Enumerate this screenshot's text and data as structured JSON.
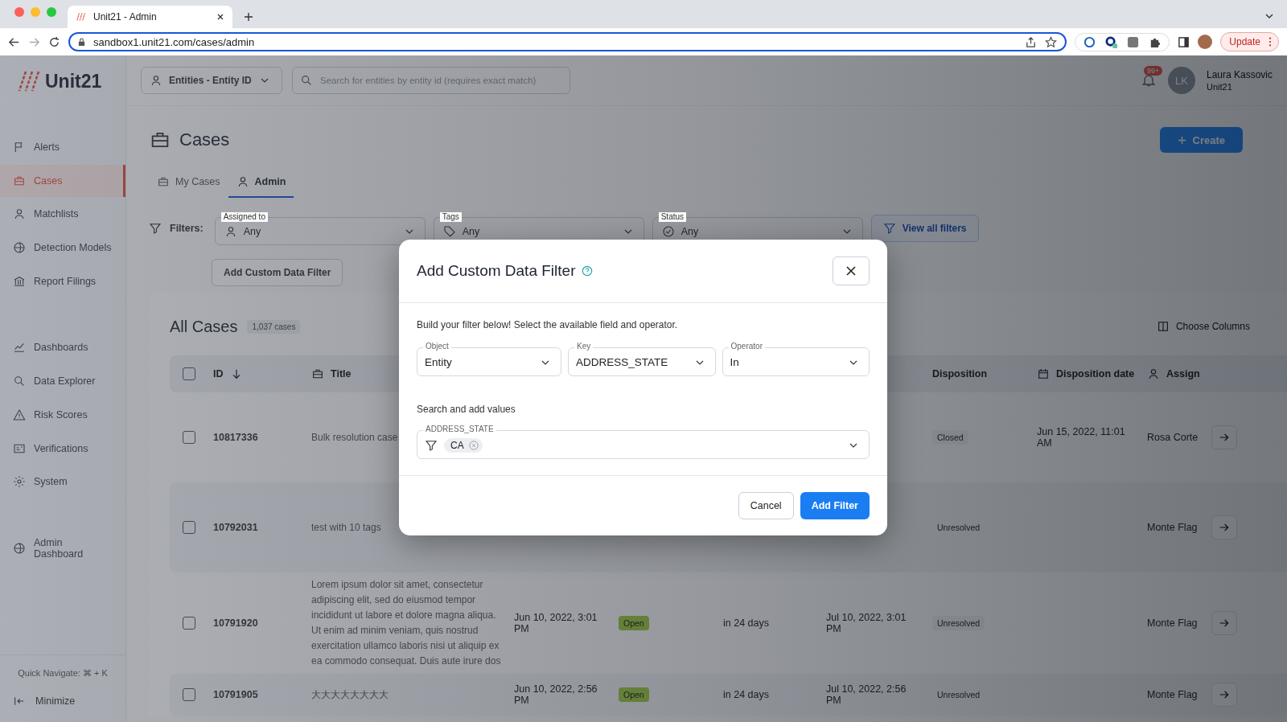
{
  "browser": {
    "tab_title": "Unit21 - Admin",
    "url": "sandbox1.unit21.com/cases/admin",
    "update_label": "Update"
  },
  "app": {
    "logo": "Unit21",
    "entity_select": "Entities - Entity ID",
    "search": {
      "placeholder": "Search for entities by entity id (requires exact match)"
    },
    "notifications": "99+",
    "avatar": "LK",
    "user_name": "Laura Kassovic",
    "user_org": "Unit21"
  },
  "sidebar": {
    "items": [
      {
        "label": "Alerts",
        "selected": false
      },
      {
        "label": "Cases",
        "selected": true
      },
      {
        "label": "Matchlists",
        "selected": false
      },
      {
        "label": "Detection Models",
        "selected": false
      },
      {
        "label": "Report Filings",
        "selected": false
      },
      {
        "label": "Dashboards",
        "selected": false
      },
      {
        "label": "Data Explorer",
        "selected": false
      },
      {
        "label": "Risk Scores",
        "selected": false
      },
      {
        "label": "Verifications",
        "selected": false
      },
      {
        "label": "System",
        "selected": false
      },
      {
        "label": "Admin Dashboard",
        "selected": false
      }
    ],
    "quick_navigate": "Quick Navigate: ⌘ + K",
    "minimize": "Minimize"
  },
  "page": {
    "title": "Cases",
    "create_button": "Create",
    "tabs": [
      {
        "label": "My Cases",
        "selected": false
      },
      {
        "label": "Admin",
        "selected": true
      }
    ],
    "filters_label": "Filters:",
    "filters": [
      {
        "label": "Assigned to",
        "value": "Any"
      },
      {
        "label": "Tags",
        "value": "Any"
      },
      {
        "label": "Status",
        "value": "Any"
      }
    ],
    "view_all_filters": "View all filters",
    "add_custom_filter": "Add Custom Data Filter"
  },
  "table": {
    "title": "All Cases",
    "count": "1,037 cases",
    "choose_columns": "Choose Columns",
    "all_checked": false,
    "columns": [
      "ID",
      "Title",
      "Disposition",
      "Disposition date",
      "Assign"
    ],
    "rows": [
      {
        "id": "10817336",
        "title": "Bulk resolution case",
        "disposition": "Closed",
        "disposition_date": "Jun 15, 2022, 11:01 AM",
        "assignee": "Rosa Corte",
        "checked": false
      },
      {
        "id": "10792031",
        "title": "test with 10 tags",
        "disposition": "Unresolved",
        "assignee": "Monte Flag",
        "checked": false
      },
      {
        "id": "10791920",
        "title": "Lorem ipsum dolor sit amet, consectetur adipiscing elit, sed do eiusmod tempor incididunt ut labore et dolore magna aliqua. Ut enim ad minim veniam, quis nostrud exercitation ullamco laboris nisi ut aliquip ex ea commodo consequat. Duis aute irure dos",
        "created": "Jun 10, 2022, 3:01 PM",
        "status": "Open",
        "due": "in 24 days",
        "closed": "Jul 10, 2022, 3:01 PM",
        "disposition": "Unresolved",
        "assignee": "Monte Flag",
        "checked": false
      },
      {
        "id": "10791905",
        "title": "大大大大大大大大",
        "created": "Jun 10, 2022, 2:56 PM",
        "status": "Open",
        "due": "in 24 days",
        "closed": "Jul 10, 2022, 2:56 PM",
        "disposition": "Unresolved",
        "assignee": "Monte Flag",
        "checked": false
      }
    ]
  },
  "modal": {
    "title": "Add Custom Data Filter",
    "intro": "Build your filter below! Select the available field and operator.",
    "selects": [
      {
        "label": "Object",
        "value": "Entity"
      },
      {
        "label": "Key",
        "value": "ADDRESS_STATE"
      },
      {
        "label": "Operator",
        "value": "In"
      }
    ],
    "values_heading": "Search and add values",
    "values_field": {
      "label": "ADDRESS_STATE",
      "chips": [
        "CA"
      ]
    },
    "cancel": "Cancel",
    "submit": "Add Filter"
  }
}
